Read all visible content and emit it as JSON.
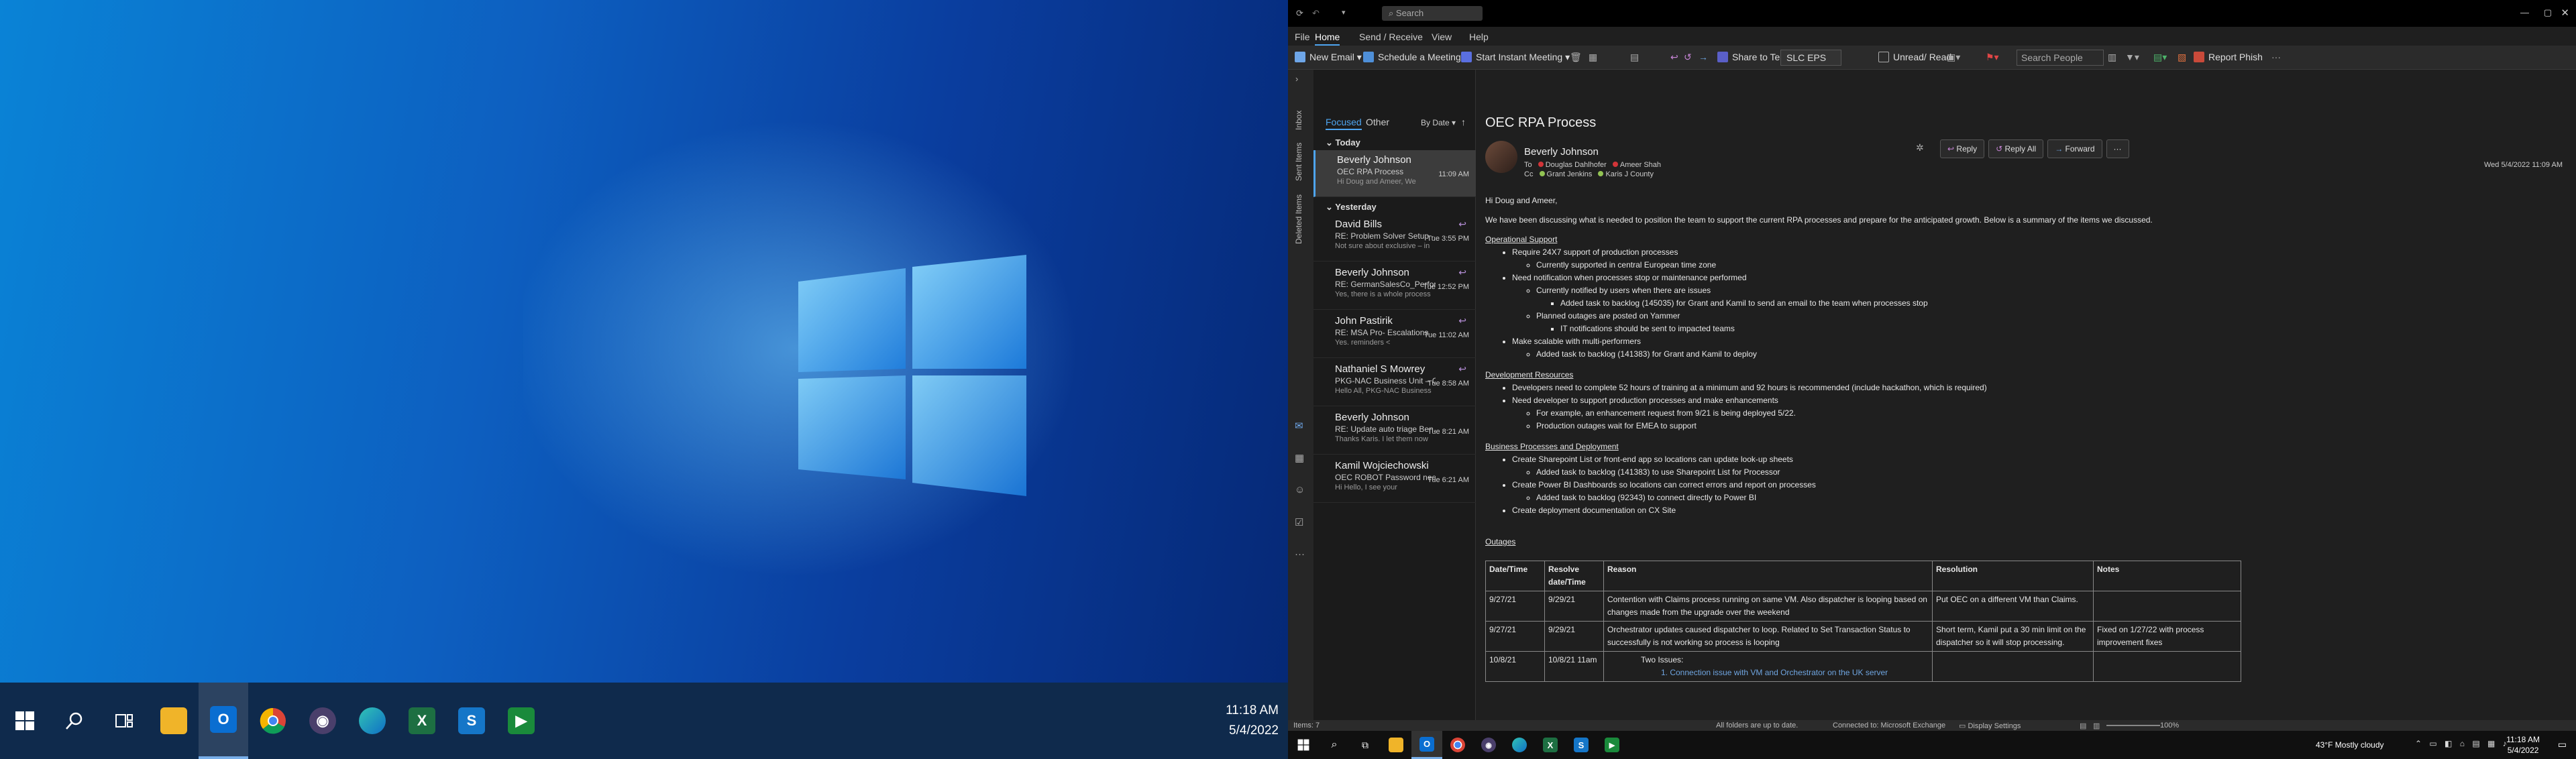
{
  "left_screen": {
    "taskbar": {
      "icons": [
        "windows-start-icon",
        "search-icon",
        "task-view-icon",
        "file-explorer-icon",
        "outlook-icon",
        "chrome-icon",
        "obs-icon",
        "edge-icon",
        "excel-icon",
        "app-s-icon",
        "app-green-icon"
      ],
      "time": "11:18 AM",
      "date": "5/4/2022"
    }
  },
  "outlook": {
    "titlebar": {
      "search_placeholder": "Search"
    },
    "menu": [
      "File",
      "Home",
      "Send / Receive",
      "View",
      "Help"
    ],
    "ribbon": {
      "new_email": "New Email",
      "schedule_meeting": "Schedule a Meeting",
      "instant_meeting": "Start Instant Meeting",
      "share_teams": "Share to Teams",
      "quickstep": "SLC EPS",
      "unread_read": "Unread/ Read",
      "search_people": "Search People",
      "report_phish": "Report Phish"
    },
    "nav_rail": {
      "inbox": "Inbox",
      "sent": "Sent Items",
      "deleted": "Deleted Items"
    },
    "list": {
      "focused": "Focused",
      "other": "Other",
      "sort": "By Date",
      "groups": {
        "today": "Today",
        "yesterday": "Yesterday"
      },
      "messages": [
        {
          "sender": "Beverly Johnson",
          "subject": "OEC RPA Process",
          "preview": "Hi Doug and Ameer,  We",
          "time": "11:09 AM"
        },
        {
          "sender": "David Bills",
          "subject": "RE: Problem Solver Setup - ...",
          "preview": "Not sure about exclusive – in",
          "time": "Tue 3:55 PM"
        },
        {
          "sender": "Beverly Johnson",
          "subject": "RE: GermanSalesCo_Perfor...",
          "preview": "Yes, there is a whole process",
          "time": "Tue 12:52 PM"
        },
        {
          "sender": "John Pastirik",
          "subject": "RE: MSA Pro- Escalations",
          "preview": "Yes.  reminders <",
          "time": "Tue 11:02 AM"
        },
        {
          "sender": "Nathaniel S Mowrey",
          "subject": "PKG-NAC Business Unit – C...",
          "preview": "Hello All,  PKG-NAC Business",
          "time": "Tue 8:58 AM"
        },
        {
          "sender": "Beverly Johnson",
          "subject": "RE: Update auto triage Ben...",
          "preview": "Thanks Karis.  I let them now",
          "time": "Tue 8:21 AM"
        },
        {
          "sender": "Kamil Wojciechowski",
          "subject": "OEC ROBOT Password nee...",
          "preview": "Hi Hello,  I see your",
          "time": "Tue 6:21 AM"
        }
      ]
    },
    "reading": {
      "subject": "OEC RPA Process",
      "sender": "Beverly Johnson",
      "to_label": "To",
      "to": [
        "Douglas Dahlhofer",
        "Ameer Shah"
      ],
      "cc_label": "Cc",
      "cc": [
        "Grant Jenkins",
        "Karis J County"
      ],
      "actions": [
        "Reply",
        "Reply All",
        "Forward"
      ],
      "date": "Wed 5/4/2022 11:09 AM",
      "greeting": "Hi Doug and Ameer,",
      "intro": "We have been discussing what is needed to position the team to support the current RPA processes and prepare for the anticipated growth.  Below is a summary of the items we discussed.",
      "sec1": "Operational Support",
      "s1": [
        "Require 24X7 support of production processes",
        "Currently supported in central European time zone",
        "Need notification when processes stop or maintenance performed",
        "Currently notified by users when there are issues",
        "Added task to backlog (145035) for Grant and Kamil to send an email to the team when processes stop",
        "Planned outages are posted on Yammer",
        "IT notifications should be sent to impacted teams",
        "Make scalable with multi-performers",
        "Added task to backlog (141383) for Grant and Kamil to deploy"
      ],
      "sec2": "Development Resources",
      "s2": [
        "Developers need to complete 52 hours of training at a minimum and 92 hours is recommended (include hackathon, which is required)",
        "Need developer to support production processes and make enhancements",
        "For example, an enhancement request from 9/21 is being deployed 5/22.",
        "Production outages wait for EMEA to support"
      ],
      "sec3": "Business Processes and Deployment",
      "s3": [
        "Create Sharepoint List or front-end app so locations can update look-up sheets",
        "Added task to backlog (141383) to use Sharepoint List for Processor",
        "Create Power BI Dashboards so locations can correct errors and report on processes",
        "Added task to backlog (92343) to connect directly to Power BI",
        "Create deployment documentation on CX Site"
      ],
      "sec4": "Outages",
      "table_headers": [
        "Date/Time",
        "Resolve date/Time",
        "Reason",
        "Resolution",
        "Notes"
      ],
      "table_rows": [
        [
          "9/27/21",
          "9/29/21",
          "Contention with Claims process running on same VM.  Also dispatcher is looping based on changes made from the upgrade over the weekend",
          "Put OEC on a different VM than Claims.",
          ""
        ],
        [
          "9/27/21",
          "9/29/21",
          "Orchestrator updates caused dispatcher to loop.  Related to Set Transaction Status to successfully is not working so process is looping",
          "Short term, Kamil put a 30 min limit on the dispatcher so it will stop processing.",
          "Fixed on 1/27/22 with process improvement fixes"
        ],
        [
          "10/8/21",
          "10/8/21 11am",
          "Two Issues:",
          "",
          ""
        ]
      ],
      "table_sub": "Connection issue with VM and Orchestrator on the UK server"
    },
    "status": {
      "items": "Items: 7",
      "sync": "All folders are up to date.",
      "connected": "Connected to: Microsoft Exchange",
      "display": "Display Settings",
      "zoom": "100%"
    },
    "taskbar": {
      "weather": "43°F  Mostly cloudy",
      "time": "11:18 AM",
      "date": "5/4/2022"
    }
  }
}
